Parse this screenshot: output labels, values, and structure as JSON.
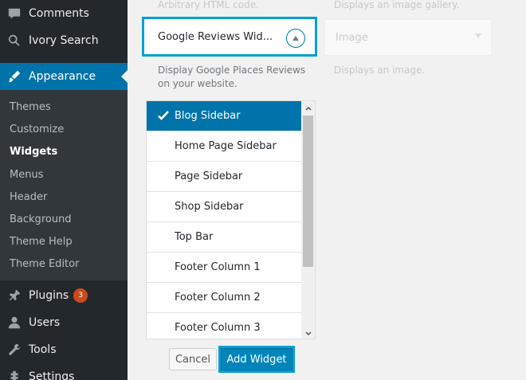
{
  "sidebar": {
    "items": [
      {
        "label": "Comments",
        "icon": "comment-icon"
      },
      {
        "label": "Ivory Search",
        "icon": "search-icon"
      },
      {
        "label": "Appearance",
        "icon": "brush-icon"
      },
      {
        "label": "Plugins",
        "icon": "plugin-icon",
        "badge": "3"
      },
      {
        "label": "Users",
        "icon": "user-icon"
      },
      {
        "label": "Tools",
        "icon": "wrench-icon"
      },
      {
        "label": "Settings",
        "icon": "settings-icon"
      }
    ],
    "submenu": [
      "Themes",
      "Customize",
      "Widgets",
      "Menus",
      "Header",
      "Background",
      "Theme Help",
      "Theme Editor"
    ],
    "current_submenu": "Widgets"
  },
  "main": {
    "top_left_faded": "Arbitrary HTML code.",
    "top_right_faded": "Displays an image gallery.",
    "widget_title": "Google Reviews Wid...",
    "image_widget_title": "Image",
    "image_widget_desc": "Displays an image.",
    "widget_desc": "Display Google Places Reviews on your website.",
    "sidebars": [
      "Blog Sidebar",
      "Home Page Sidebar",
      "Page Sidebar",
      "Shop Sidebar",
      "Top Bar",
      "Footer Column 1",
      "Footer Column 2",
      "Footer Column 3"
    ],
    "selected_sidebar": "Blog Sidebar",
    "cancel_label": "Cancel",
    "add_label": "Add Widget"
  },
  "colors": {
    "accent": "#0073aa",
    "highlight": "#00a0d2",
    "sidebar_bg": "#23282d",
    "badge": "#ca4a1f"
  }
}
